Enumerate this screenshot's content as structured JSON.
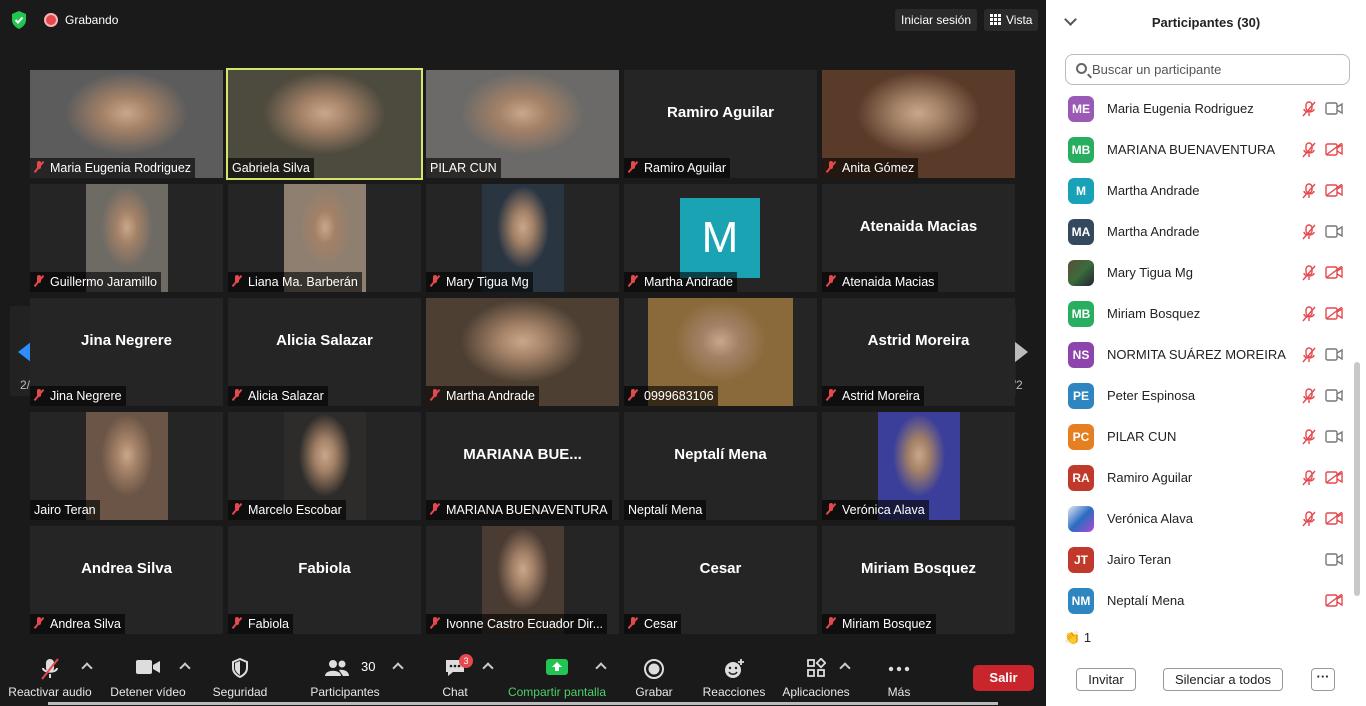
{
  "topbar": {
    "recording_label": "Grabando",
    "signin_label": "Iniciar sesión",
    "view_label": "Vista"
  },
  "pagination": {
    "left": "2/2",
    "right": "2/2"
  },
  "tiles": [
    {
      "label": "Maria Eugenia Rodriguez",
      "muted": true,
      "photo": "#5c5c5c"
    },
    {
      "label": "Gabriela Silva",
      "muted": false,
      "photo": "#4d4a3e"
    },
    {
      "label": "PILAR CUN",
      "muted": false,
      "photo": "#6b6a68"
    },
    {
      "label": "Ramiro Aguilar",
      "display": "Ramiro Aguilar",
      "muted": true
    },
    {
      "label": "Anita Gómez",
      "muted": true,
      "photo": "#5a3b2a"
    },
    {
      "label": "Guillermo Jaramillo",
      "muted": true,
      "photo": "#6e6a64"
    },
    {
      "label": "Liana Ma. Barberán",
      "muted": true,
      "photo": "#8e7f70"
    },
    {
      "label": "Mary Tigua Mg",
      "muted": true,
      "photo": "#2a3542"
    },
    {
      "label": "Martha Andrade",
      "monogram": "M",
      "muted": true
    },
    {
      "label": "Atenaida Macias",
      "display": "Atenaida Macias",
      "muted": true
    },
    {
      "label": "Jina Negrere",
      "display": "Jina Negrere",
      "muted": true
    },
    {
      "label": "Alicia Salazar",
      "display": "Alicia Salazar",
      "muted": true
    },
    {
      "label": "Martha Andrade",
      "muted": true,
      "photo": "#4d4033"
    },
    {
      "label": "0999683106",
      "muted": true,
      "photo": "#8a6a3a"
    },
    {
      "label": "Astrid Moreira",
      "display": "Astrid Moreira",
      "muted": true
    },
    {
      "label": "Jairo Teran",
      "muted": false,
      "photo": "#6b5546"
    },
    {
      "label": "Marcelo Escobar",
      "muted": true,
      "photo": "#2e2c2a"
    },
    {
      "label": "MARIANA BUENAVENTURA",
      "display": "MARIANA BUE...",
      "muted": true
    },
    {
      "label": "Neptalí Mena",
      "display": "Neptalí Mena",
      "muted": false
    },
    {
      "label": "Verónica Alava",
      "muted": true,
      "photo": "#3b3f9a"
    },
    {
      "label": "Andrea Silva",
      "display": "Andrea Silva",
      "muted": true
    },
    {
      "label": "Fabiola",
      "display": "Fabiola",
      "muted": true
    },
    {
      "label": "Ivonne Castro Ecuador Dir...",
      "muted": true,
      "photo": "#4a3b33"
    },
    {
      "label": "Cesar",
      "display": "Cesar",
      "muted": true
    },
    {
      "label": "Miriam Bosquez",
      "display": "Miriam Bosquez",
      "muted": true
    }
  ],
  "toolbar": {
    "audio_label": "Reactivar audio",
    "video_label": "Detener vídeo",
    "security_label": "Seguridad",
    "participants_label": "Participantes",
    "participants_count": "30",
    "chat_label": "Chat",
    "chat_badge": "3",
    "share_label": "Compartir pantalla",
    "record_label": "Grabar",
    "reactions_label": "Reacciones",
    "apps_label": "Aplicaciones",
    "more_label": "Más",
    "exit_label": "Salir"
  },
  "panel": {
    "title": "Participantes (30)",
    "search_placeholder": "Buscar un participante",
    "participants": [
      {
        "initials": "ME",
        "name": "Maria Eugenia Rodriguez",
        "color": "#9b59b6",
        "mic_muted": true,
        "cam_off": false
      },
      {
        "initials": "MB",
        "name": "MARIANA BUENAVENTURA",
        "color": "#27ae60",
        "mic_muted": true,
        "cam_off": true
      },
      {
        "initials": "M",
        "name": "Martha Andrade",
        "color": "#17a2b8",
        "mic_muted": true,
        "cam_off": true
      },
      {
        "initials": "MA",
        "name": "Martha Andrade",
        "color": "#34495e",
        "mic_muted": true,
        "cam_off": false
      },
      {
        "initials": "",
        "name": "Mary Tigua Mg",
        "color": "photo",
        "mic_muted": true,
        "cam_off": true
      },
      {
        "initials": "MB",
        "name": "Miriam Bosquez",
        "color": "#27ae60",
        "mic_muted": true,
        "cam_off": true
      },
      {
        "initials": "NS",
        "name": "NORMITA SUÁREZ MOREIRA",
        "color": "#8e44ad",
        "mic_muted": true,
        "cam_off": false
      },
      {
        "initials": "PE",
        "name": "Peter Espinosa",
        "color": "#2e86c1",
        "mic_muted": true,
        "cam_off": false
      },
      {
        "initials": "PC",
        "name": "PILAR CUN",
        "color": "#e67e22",
        "mic_muted": true,
        "cam_off": false
      },
      {
        "initials": "RA",
        "name": "Ramiro Aguilar",
        "color": "#c0392b",
        "mic_muted": true,
        "cam_off": true
      },
      {
        "initials": "",
        "name": "Verónica Alava",
        "color": "photo2",
        "mic_muted": true,
        "cam_off": true
      },
      {
        "initials": "JT",
        "name": "Jairo Teran",
        "color": "#c0392b",
        "mic_muted": false,
        "cam_off": false
      },
      {
        "initials": "NM",
        "name": "Neptalí Mena",
        "color": "#2e86c1",
        "mic_muted": false,
        "cam_off": true
      }
    ],
    "reaction_count": "1",
    "invite_label": "Invitar",
    "mute_all_label": "Silenciar a todos",
    "more_label": "···"
  }
}
